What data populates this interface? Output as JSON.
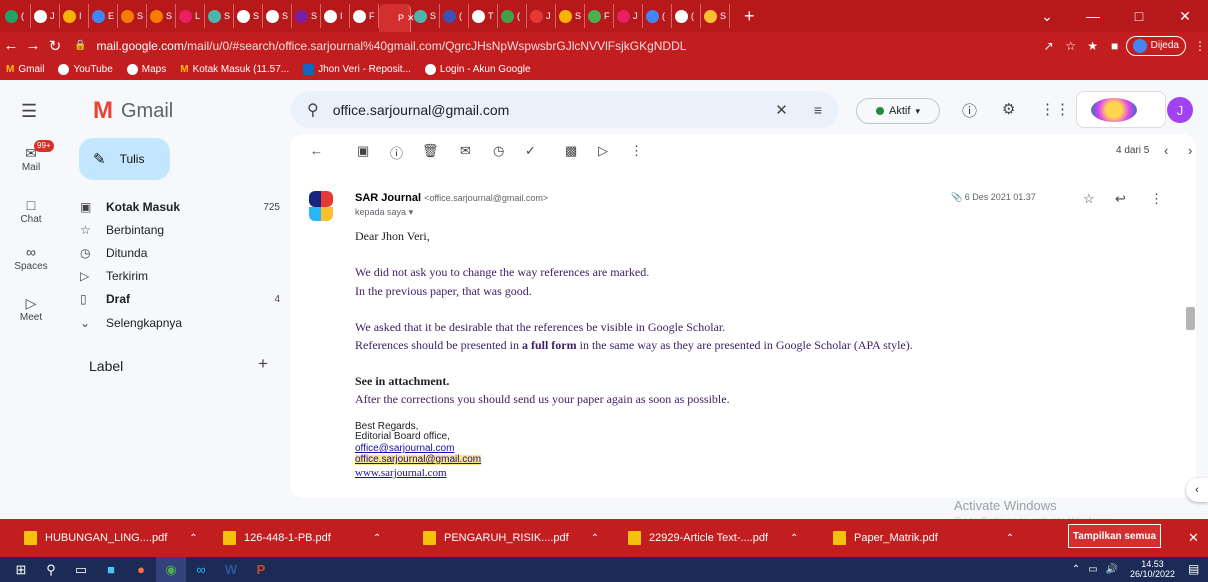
{
  "browser": {
    "tabs": [
      {
        "label": "(",
        "color": "#21a366"
      },
      {
        "label": "J",
        "color": "#ffffff"
      },
      {
        "label": "I",
        "color": "#f4b400"
      },
      {
        "label": "E",
        "color": "#4285f4"
      },
      {
        "label": "S",
        "color": "#f57c00"
      },
      {
        "label": "S",
        "color": "#f57c00"
      },
      {
        "label": "L",
        "color": "#e91e63"
      },
      {
        "label": "S",
        "color": "#4db6ac"
      },
      {
        "label": "S",
        "color": "#ffffff"
      },
      {
        "label": "S",
        "color": "#ffffff"
      },
      {
        "label": "S",
        "color": "#7b1fa2"
      },
      {
        "label": "I",
        "color": "#ffffff"
      },
      {
        "label": "F",
        "color": "#ffffff"
      },
      {
        "label": "P",
        "color": "#d32f2f"
      },
      {
        "label": "S",
        "color": "#4db6ac"
      },
      {
        "label": "(",
        "color": "#3f51b5"
      },
      {
        "label": "T",
        "color": "#ffffff"
      },
      {
        "label": "(",
        "color": "#43a047"
      },
      {
        "label": "J",
        "color": "#e53935"
      },
      {
        "label": "S",
        "color": "#f4b400"
      },
      {
        "label": "F",
        "color": "#4caf50"
      },
      {
        "label": "J",
        "color": "#e91e63"
      },
      {
        "label": "(",
        "color": "#4285f4"
      },
      {
        "label": "(",
        "color": "#ffffff"
      },
      {
        "label": "S",
        "color": "#fbc02d"
      }
    ],
    "active_tab_label": "P",
    "new_tab": "+",
    "window_controls": [
      "⌄",
      "—",
      "□",
      "✕"
    ],
    "url_host": "mail.google.com",
    "url_path": "/mail/u/0/#search/office.sarjournal%40gmail.com/QgrcJHsNpWspwsbrGJlcNVVlFsjkGKgNDDL",
    "profile_name": "Dijeda",
    "bookmarks": [
      "Gmail",
      "YouTube",
      "Maps",
      "Kotak Masuk (11.57...",
      "Jhon Veri - Reposit...",
      "Login - Akun Google"
    ]
  },
  "gmail": {
    "app_name": "Gmail",
    "compose_label": "Tulis",
    "rail": [
      {
        "label": "Mail",
        "badge": "99+"
      },
      {
        "label": "Chat"
      },
      {
        "label": "Spaces"
      },
      {
        "label": "Meet"
      }
    ],
    "nav": [
      {
        "label": "Kotak Masuk",
        "count": "725",
        "bold": true
      },
      {
        "label": "Berbintang",
        "count": ""
      },
      {
        "label": "Ditunda",
        "count": ""
      },
      {
        "label": "Terkirim",
        "count": ""
      },
      {
        "label": "Draf",
        "count": "4",
        "bold": true
      },
      {
        "label": "Selengkapnya",
        "count": ""
      }
    ],
    "label_header": "Label",
    "label_add": "+",
    "search_value": "office.sarjournal@gmail.com",
    "status_label": "Aktif",
    "avatar_letter": "J",
    "pagination": "4 dari 5"
  },
  "message": {
    "sender_name": "SAR Journal",
    "sender_email": "<office.sarjournal@gmail.com>",
    "recipient": "kepada saya",
    "date": "6 Des 2021 01.37",
    "greeting": "Dear Jhon Veri,",
    "p1": "We did not ask you to change the way references are marked.",
    "p2": "In the previous paper, that was good.",
    "p3": "We asked that it be desirable that the references be visible in Google Scholar.",
    "p4a": "References should be presented in ",
    "p4b": "a full form",
    "p4c": " in the same way as they are presented in Google Scholar (APA style).",
    "p5": "See in attachment.",
    "p6": "After the corrections you should send us your paper again as soon as possible.",
    "sig1": "Best Regards,",
    "sig2": "Editorial Board office,",
    "sig3": "office@sarjournal.com",
    "sig4": "office.sarjournal@gmail.com",
    "sig5": "www.sarjournal.com"
  },
  "downloads": {
    "items": [
      "HUBUNGAN_LING....pdf",
      "126-448-1-PB.pdf",
      "PENGARUH_RISIK....pdf",
      "22929-Article Text-....pdf",
      "Paper_Matrik.pdf"
    ],
    "show_all": "Tampilkan semua"
  },
  "watermark": {
    "line1": "Activate Windows",
    "line2": "Go to Settings to activate Windows."
  },
  "taskbar": {
    "time": "14.53",
    "date": "26/10/2022"
  },
  "colors": {
    "chrome_red": "#c21e1f",
    "compose_blue": "#c2e7ff",
    "active_green": "#1e8e3e",
    "avatar_purple": "#a142f4"
  }
}
